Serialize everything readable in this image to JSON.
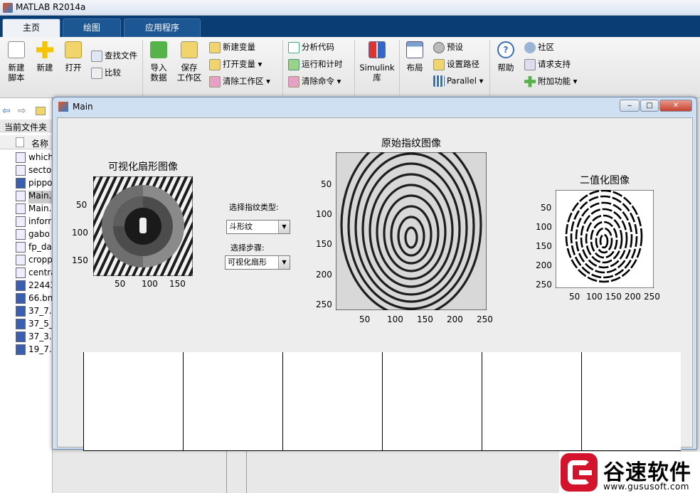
{
  "app": {
    "title": "MATLAB R2014a"
  },
  "tabs": [
    {
      "label": "主页"
    },
    {
      "label": "绘图"
    },
    {
      "label": "应用程序"
    }
  ],
  "ribbon": {
    "new_script": "新建\n脚本",
    "new": "新建",
    "open": "打开",
    "find_files": "查找文件",
    "compare": "比较",
    "import": "导入\n数据",
    "save_ws": "保存\n工作区",
    "new_var": "新建变量",
    "open_var": "打开变量",
    "clear_ws": "清除工作区",
    "analyze": "分析代码",
    "run_time": "运行和计时",
    "clear_cmd": "清除命令",
    "simulink": "Simulink\n库",
    "layout": "布局",
    "prefs": "预设",
    "set_path": "设置路径",
    "parallel": "Parallel",
    "help": "帮助",
    "community": "社区",
    "support": "请求支持",
    "addons": "附加功能"
  },
  "current_folder": {
    "label": "当前文件夹",
    "name_col": "名称",
    "files": [
      "which",
      "secto",
      "pippo",
      "Main.",
      "Main.",
      "inforr",
      "gabo",
      "fp_da",
      "cropp",
      "centra",
      "22443",
      "66.bn",
      "37_7.",
      "37_5_",
      "37_3.",
      "19_7."
    ]
  },
  "figure": {
    "title": "Main",
    "plot1": {
      "title": "可视化扇形图像",
      "yticks": [
        "50",
        "100",
        "150"
      ],
      "xticks": [
        "50",
        "100",
        "150"
      ]
    },
    "plot2": {
      "title": "原始指纹图像",
      "yticks": [
        "50",
        "100",
        "150",
        "200",
        "250"
      ],
      "xticks": [
        "50",
        "100",
        "150",
        "200",
        "250"
      ]
    },
    "plot3": {
      "title": "二值化图像",
      "yticks": [
        "50",
        "100",
        "150",
        "200",
        "250"
      ],
      "xticks": [
        "50",
        "100",
        "150",
        "200",
        "250"
      ]
    },
    "type_label": "选择指纹类型:",
    "type_value": "斗形纹",
    "step_label": "选择步骤:",
    "step_value": "可视化扇形"
  },
  "watermark": {
    "brand": "谷速软件",
    "url": "www.gususoft.com"
  }
}
